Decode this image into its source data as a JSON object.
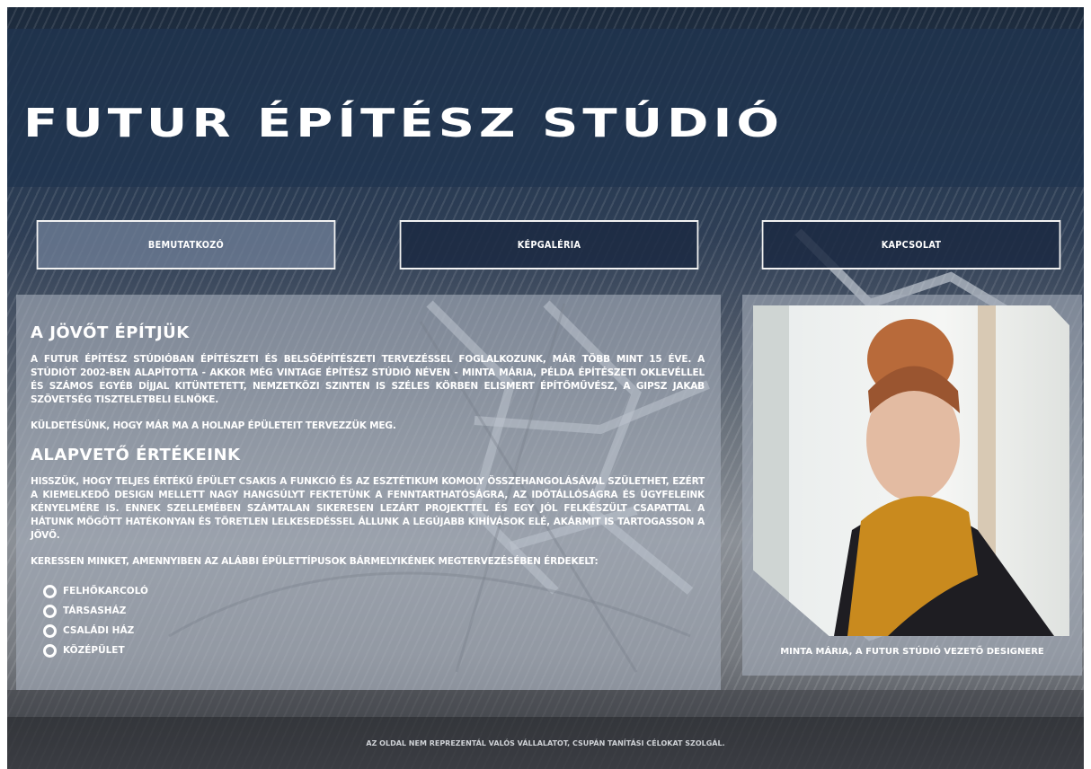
{
  "header": {
    "title": "Futur Építész Stúdió"
  },
  "nav": {
    "items": [
      {
        "label": "Bemutatkozó"
      },
      {
        "label": "Képgaléria"
      },
      {
        "label": "Kapcsolat"
      }
    ]
  },
  "main": {
    "heading1": "A jövőt építjük",
    "paragraph1": "A Futur Építész Stúdióban építészeti és belsőépítészeti tervezéssel foglalkozunk, már több mint 15 éve. A stúdiót 2002-ben alapította - akkor még Vintage Építész Stúdió néven - Minta Mária, példa építészeti oklevéllel és számos egyéb díjjal kitüntetett, nemzetközi szinten is széles körben elismert építőművész, a Gipsz Jakab Szövetség tiszteletbeli elnöke.",
    "paragraph2": "Küldetésünk, hogy már ma a holnap épületeit tervezzük meg.",
    "heading2": "Alapvető értékeink",
    "paragraph3": "Hisszük, hogy teljes értékű épület csakis a funkció és az esztétikum komoly összehangolásával születhet, ezért a kiemelkedő design mellett nagy hangsúlyt fektetünk a fenntarthatóságra, az időtállóságra és ügyfeleink kényelmére is. Ennek szellemében számtalan sikeresen lezárt projekttel és egy jól felkészült csapattal a hátunk mögött hatékonyan és töretlen lelkesedéssel állunk a legújabb kihívások elé, akármit is tartogasson a jövő.",
    "paragraph4": "Keressen minket, amennyiben az alábbi épülettípusok bármelyikének megtervezésében érdekelt:",
    "building_types": [
      "Felhőkarcoló",
      "Társasház",
      "Családi ház",
      "Középület"
    ]
  },
  "side": {
    "caption": "Minta Mária, a Futur Stúdió vezető designere"
  },
  "footer": {
    "text": "Az oldal nem reprezentál valós vállalatot, csupán tanítási célokat szolgál."
  }
}
